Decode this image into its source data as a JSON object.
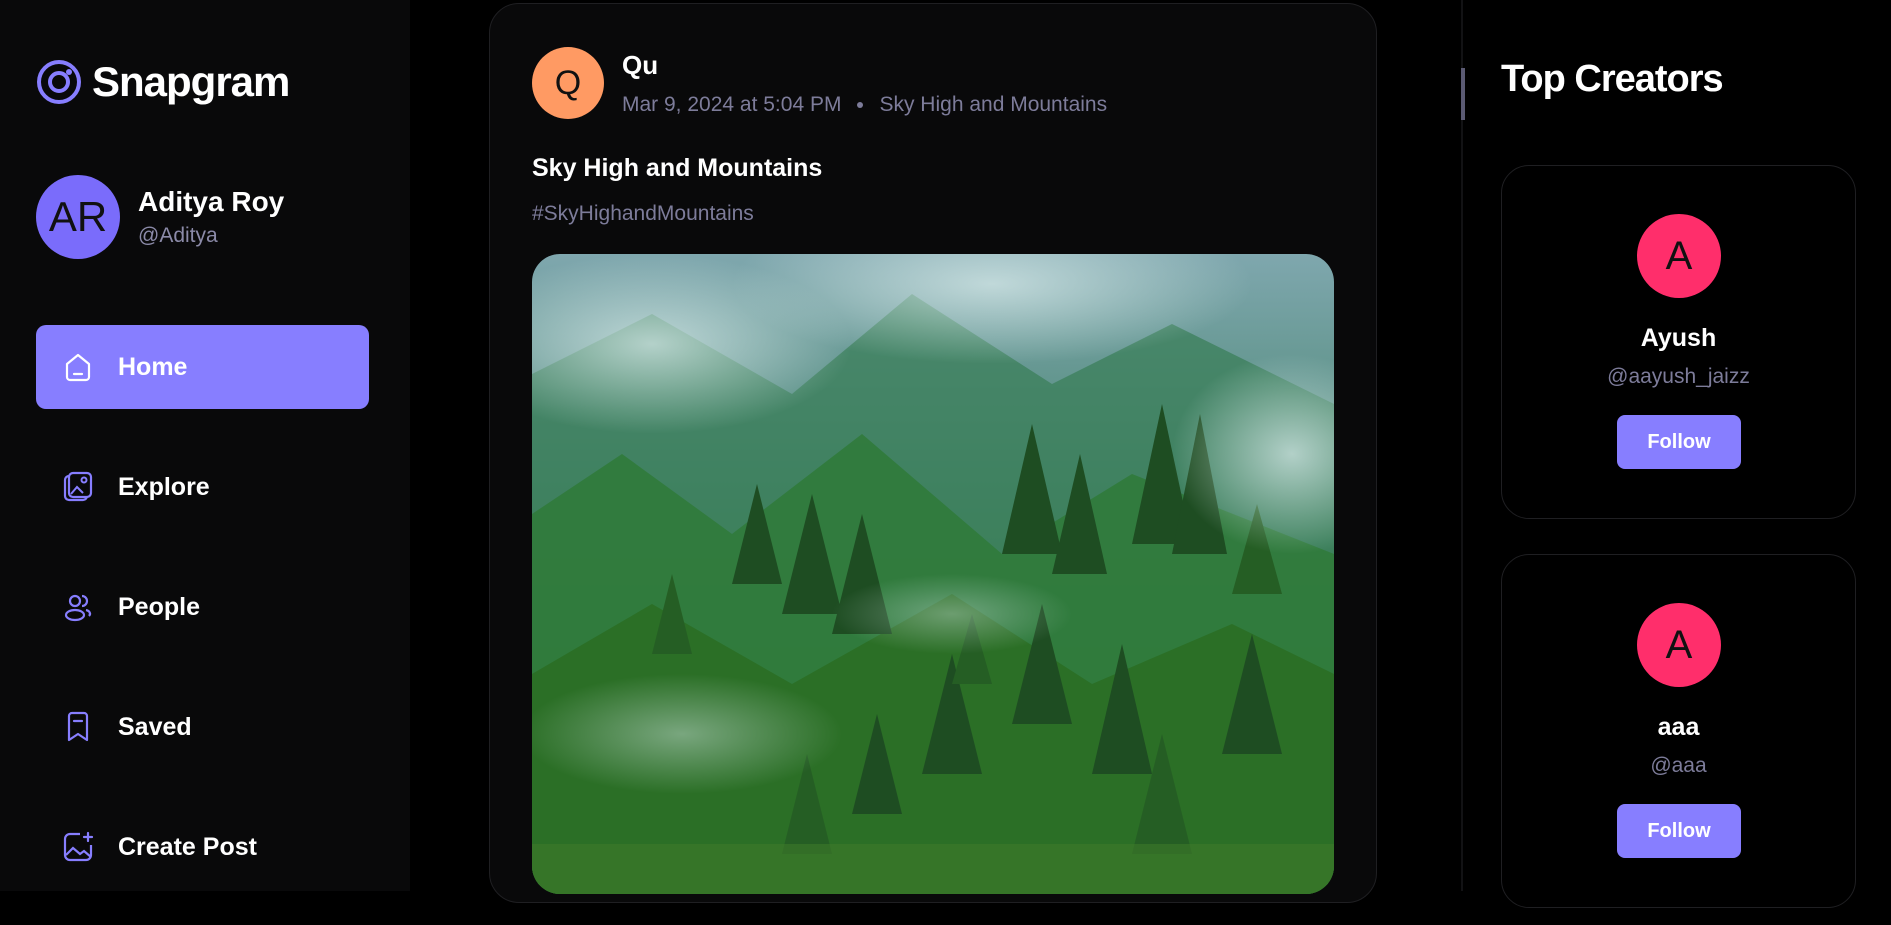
{
  "app": {
    "name": "Snapgram",
    "logo_icon": "snapgram-logo-icon",
    "accent": "#877eff"
  },
  "user": {
    "initials": "AR",
    "name": "Aditya Roy",
    "handle": "@Aditya"
  },
  "nav": [
    {
      "label": "Home",
      "icon": "home-icon",
      "active": true
    },
    {
      "label": "Explore",
      "icon": "gallery-icon",
      "active": false
    },
    {
      "label": "People",
      "icon": "people-icon",
      "active": false
    },
    {
      "label": "Saved",
      "icon": "bookmark-icon",
      "active": false
    },
    {
      "label": "Create Post",
      "icon": "add-image-icon",
      "active": false
    }
  ],
  "post": {
    "author_initial": "Q",
    "author": "Qu",
    "date": "Mar 9, 2024 at 5:04 PM",
    "location": "Sky High and Mountains",
    "caption": "Sky High and Mountains",
    "tags": "#SkyHighandMountains",
    "image": "misty-green-mountain-forest"
  },
  "right": {
    "title": "Top Creators",
    "creators": [
      {
        "initial": "A",
        "name": "Ayush",
        "handle": "@aayush_jaizz",
        "button": "Follow"
      },
      {
        "initial": "A",
        "name": "aaa",
        "handle": "@aaa",
        "button": "Follow"
      }
    ]
  }
}
